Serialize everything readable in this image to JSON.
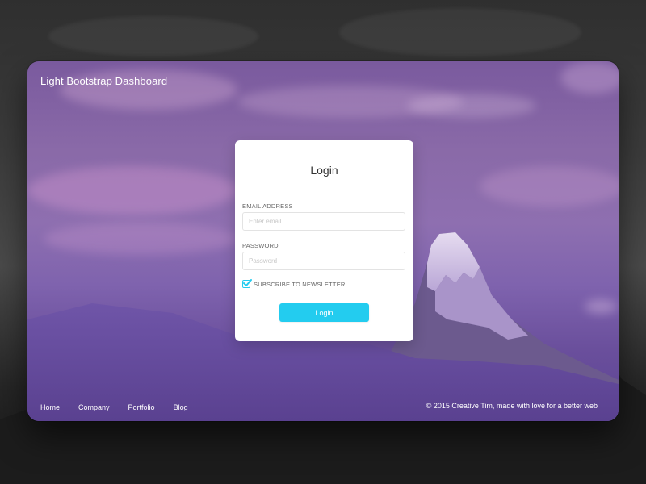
{
  "app": {
    "brand": "Light Bootstrap Dashboard"
  },
  "login_card": {
    "title": "Login",
    "email": {
      "label": "EMAIL ADDRESS",
      "placeholder": "Enter email",
      "value": ""
    },
    "password": {
      "label": "PASSWORD",
      "placeholder": "Password",
      "value": ""
    },
    "subscribe": {
      "label": "SUBSCRIBE TO NEWSLETTER",
      "checked": true
    },
    "submit_label": "Login"
  },
  "footer": {
    "links": [
      {
        "label": "Home"
      },
      {
        "label": "Company"
      },
      {
        "label": "Portfolio"
      },
      {
        "label": "Blog"
      }
    ],
    "copyright": "© 2015 Creative Tim, made with love for a better web"
  },
  "colors": {
    "accent": "#23ccef",
    "window_overlay": "#7a5aa6",
    "card_bg": "#ffffff",
    "backdrop": "#3a3a3a"
  },
  "icons": {
    "checkbox": "check-icon"
  }
}
